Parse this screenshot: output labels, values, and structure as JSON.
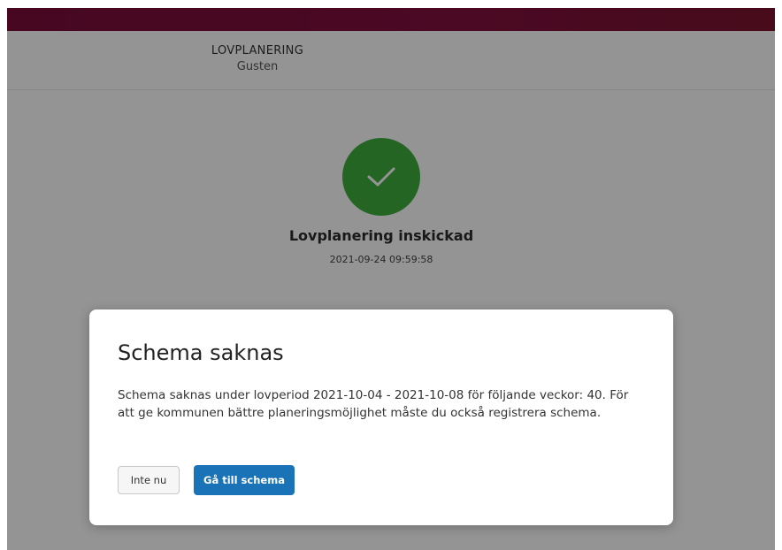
{
  "header": {
    "title": "LOVPLANERING",
    "subtitle": "Gusten"
  },
  "status": {
    "icon": "checkmark-icon",
    "color": "#3fae3f",
    "title": "Lovplanering inskickad",
    "timestamp": "2021-09-24 09:59:58"
  },
  "modal": {
    "title": "Schema saknas",
    "body": "Schema saknas under lovperiod 2021-10-04 - 2021-10-08 för följande veckor: 40. För att ge kommunen bättre planeringsmöjlighet måste du också registrera schema.",
    "secondary_button": "Inte nu",
    "primary_button": "Gå till schema"
  },
  "colors": {
    "topbar": "#7a0d3a",
    "primary": "#1a73b7"
  }
}
